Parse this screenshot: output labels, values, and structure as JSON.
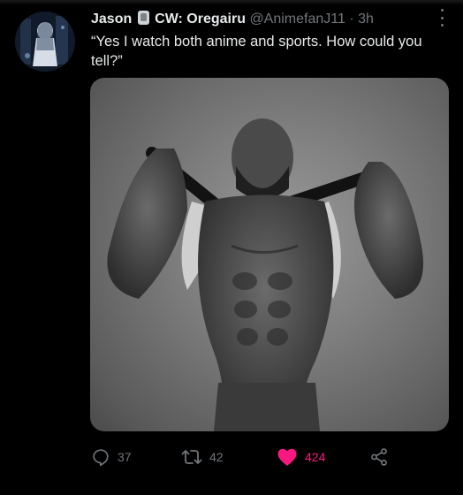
{
  "tweet": {
    "display_name": "Jason",
    "name_suffix": "CW: Oregairu",
    "handle": "@AnimefanJ11",
    "separator": "·",
    "time": "3h",
    "text": "“Yes I watch both anime and sports. How could you tell?”"
  },
  "actions": {
    "replies": "37",
    "retweets": "42",
    "likes": "424"
  },
  "colors": {
    "like_active": "#f91880",
    "muted": "#71767b",
    "text": "#e7e9ea",
    "background": "#000000"
  },
  "icons": [
    "avatar-image",
    "badge-icon",
    "more-icon",
    "reply-icon",
    "retweet-icon",
    "heart-icon",
    "share-icon"
  ]
}
